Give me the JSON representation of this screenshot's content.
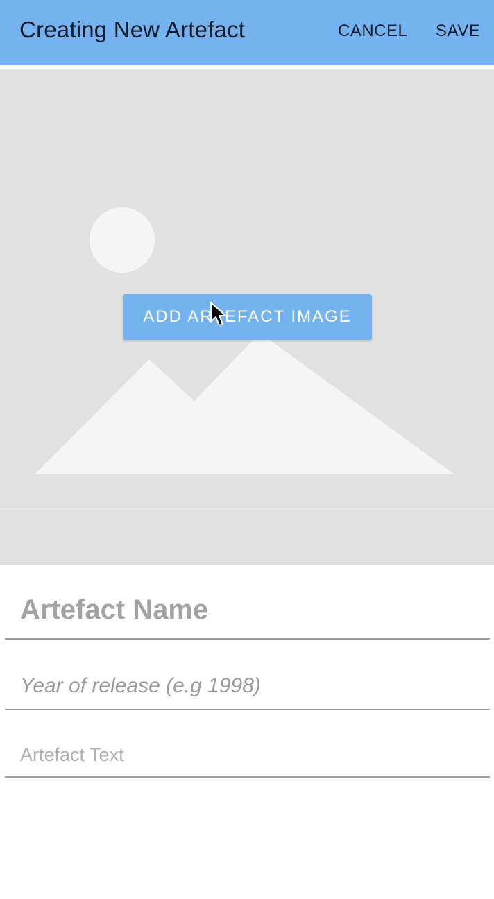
{
  "app_bar": {
    "title": "Creating New Artefact",
    "cancel_label": "CANCEL",
    "save_label": "SAVE",
    "color": "#74b3ef"
  },
  "image_picker": {
    "button_label": "ADD ARTEFACT IMAGE",
    "placeholder_icon": "image-placeholder-icon",
    "cursor_icon": "mouse-pointer-icon"
  },
  "form": {
    "name_placeholder": "Artefact Name",
    "year_placeholder": "Year of release (e.g 1998)",
    "text_placeholder": "Artefact Text"
  }
}
